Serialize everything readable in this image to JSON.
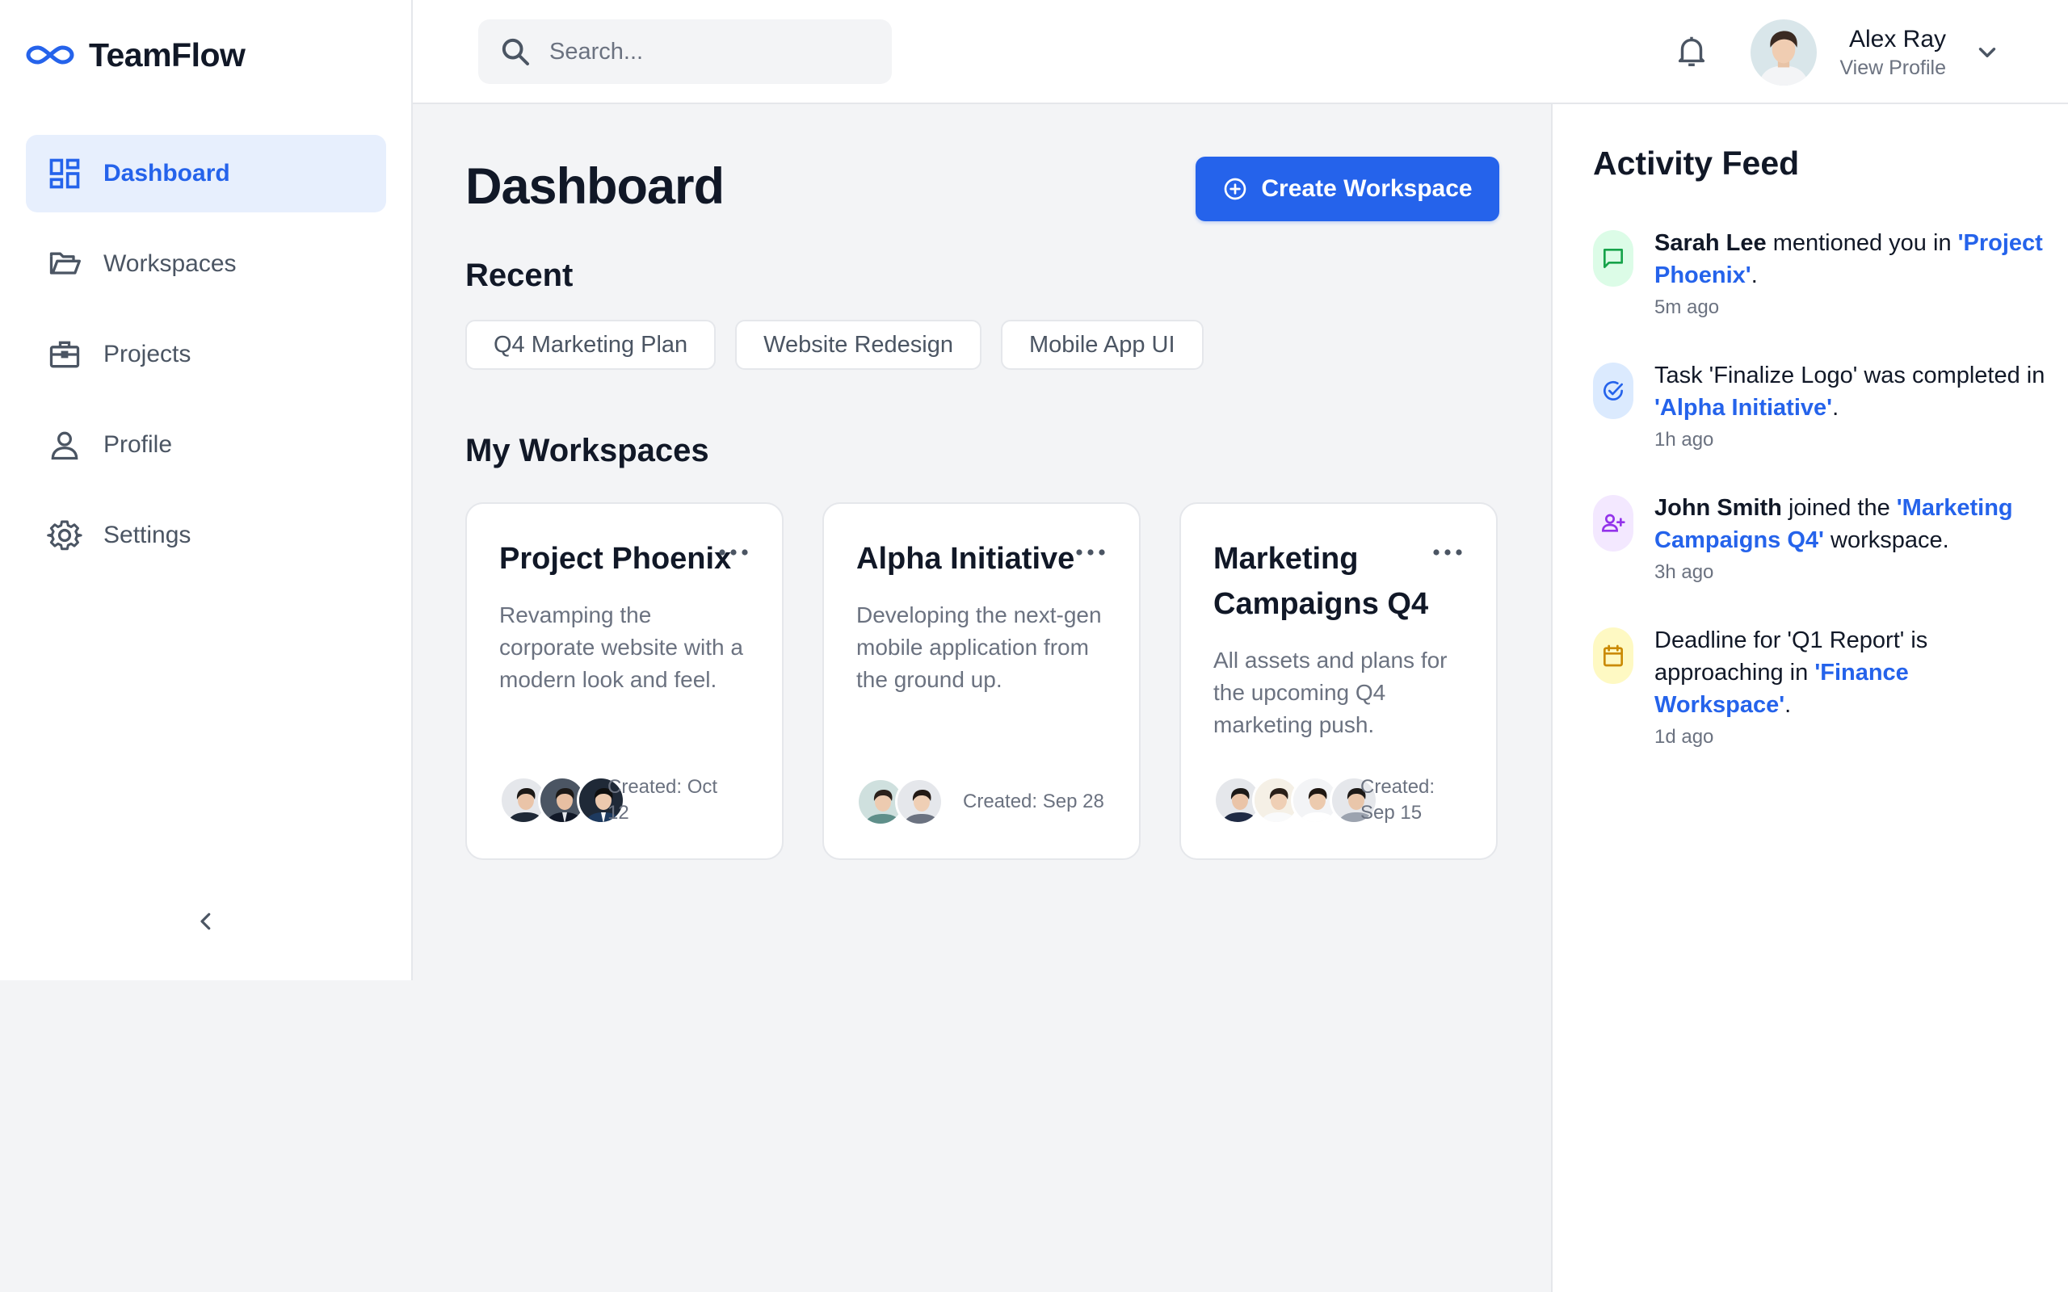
{
  "app": {
    "name": "TeamFlow",
    "accent": "#2563eb"
  },
  "sidebar": {
    "items": [
      {
        "label": "Dashboard",
        "icon": "dashboard-icon",
        "active": true
      },
      {
        "label": "Workspaces",
        "icon": "folder-icon"
      },
      {
        "label": "Projects",
        "icon": "briefcase-icon"
      },
      {
        "label": "Profile",
        "icon": "user-icon"
      },
      {
        "label": "Settings",
        "icon": "gear-icon"
      }
    ],
    "collapse_icon": "chevron-left-icon"
  },
  "header": {
    "search_placeholder": "Search...",
    "notification_icon": "bell-icon",
    "user": {
      "name": "Alex Ray",
      "subtitle": "View Profile"
    }
  },
  "main": {
    "title": "Dashboard",
    "create_button": "Create Workspace",
    "recent_title": "Recent",
    "recent": [
      "Q4 Marketing Plan",
      "Website Redesign",
      "Mobile App UI"
    ],
    "workspaces_title": "My Workspaces",
    "workspaces": [
      {
        "title": "Project Phoenix",
        "description": "Revamping the corporate website with a modern look and feel.",
        "created": "Created: Oct 12",
        "member_count": 3
      },
      {
        "title": "Alpha Initiative",
        "description": "Developing the next-gen mobile application from the ground up.",
        "created": "Created: Sep 28",
        "member_count": 2
      },
      {
        "title": "Marketing Campaigns Q4",
        "description": "All assets and plans for the upcoming Q4 marketing push.",
        "created": "Created: Sep 15",
        "member_count": 4
      }
    ]
  },
  "feed": {
    "title": "Activity Feed",
    "items": [
      {
        "icon": "message-icon",
        "actor": "Sarah Lee",
        "text": " mentioned you in ",
        "link": "'Project Phoenix'",
        "suffix": ".",
        "time": "5m ago",
        "color": "#16a34a",
        "bg": "#dcfce7"
      },
      {
        "icon": "check-circle-icon",
        "actor": "",
        "text": "Task 'Finalize Logo' was completed in ",
        "link": "'Alpha Initiative'",
        "suffix": ".",
        "time": "1h ago",
        "color": "#2563eb",
        "bg": "#dbeafe"
      },
      {
        "icon": "user-plus-icon",
        "actor": "John Smith",
        "text": " joined the ",
        "link": "'Marketing Campaigns Q4'",
        "suffix": " workspace.",
        "time": "3h ago",
        "color": "#9333ea",
        "bg": "#f3e8ff"
      },
      {
        "icon": "calendar-icon",
        "actor": "",
        "text": "Deadline for 'Q1 Report' is approaching in ",
        "link": "'Finance Workspace'",
        "suffix": ".",
        "time": "1d ago",
        "color": "#ca8a04",
        "bg": "#fef9c3"
      }
    ]
  }
}
